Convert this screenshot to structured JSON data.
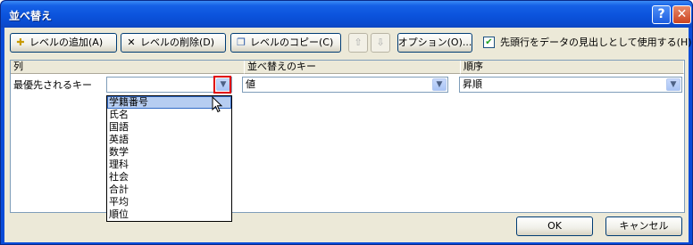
{
  "window": {
    "title": "並べ替え",
    "help_glyph": "?",
    "close_glyph": "✕"
  },
  "toolbar": {
    "add_level_label": "レベルの追加(A)",
    "delete_level_label": "レベルの削除(D)",
    "copy_level_label": "レベルのコピー(C)",
    "up_glyph": "⇧",
    "down_glyph": "⇩",
    "options_label": "オプション(O)...",
    "header_checkbox_label": "先頭行をデータの見出しとして使用する(H)",
    "header_checkbox_checked": "✔"
  },
  "grid": {
    "headers": {
      "column": "列",
      "sort_on": "並べ替えのキー",
      "order": "順序"
    },
    "rows": [
      {
        "label": "最優先されるキー",
        "column_value": "",
        "sort_on_value": "値",
        "order_value": "昇順"
      }
    ]
  },
  "dropdown": {
    "options": [
      "学籍番号",
      "氏名",
      "国語",
      "英語",
      "数学",
      "理科",
      "社会",
      "合計",
      "平均",
      "順位"
    ],
    "highlighted": "学籍番号"
  },
  "footer": {
    "ok_label": "OK",
    "cancel_label": "キャンセル"
  },
  "colors": {
    "titlebar": "#0a4cd8",
    "dialog_bg": "#ece9d8",
    "highlight_box": "#e00000",
    "selection": "#b6cdf1"
  }
}
